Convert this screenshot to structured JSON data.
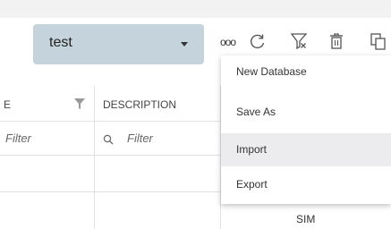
{
  "toolbar": {
    "selected_database": "test",
    "more_label": "ooo"
  },
  "grid": {
    "columns": [
      {
        "label": "E"
      },
      {
        "label": "DESCRIPTION"
      }
    ],
    "filter_placeholder": "Filter",
    "partial_cell_text": "SIM"
  },
  "menu": {
    "items": [
      {
        "label": "New Database"
      },
      {
        "label": "Save As"
      },
      {
        "label": "Import",
        "active": true
      },
      {
        "label": "Export"
      }
    ]
  },
  "colors": {
    "select_background": "#c5d4dc",
    "menu_hover": "#ececef",
    "icon_gray": "#555555"
  }
}
